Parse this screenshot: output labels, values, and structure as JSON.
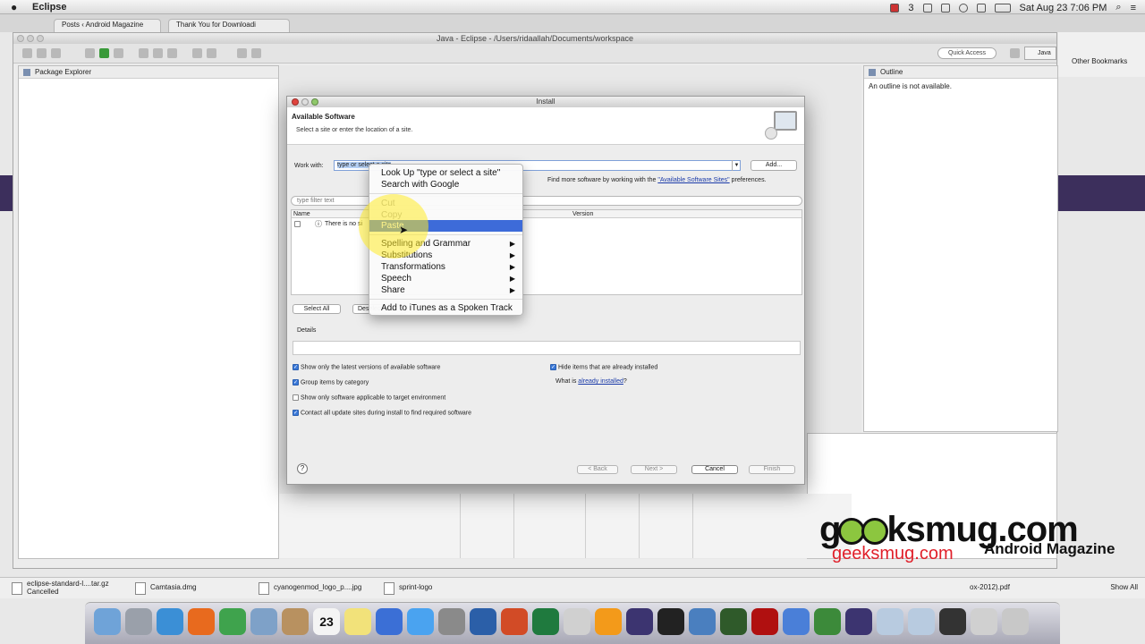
{
  "menubar": {
    "app_name": "Eclipse",
    "apple": "",
    "clock": "Sat Aug 23  7:06 PM",
    "badge": "3"
  },
  "chrome": {
    "tabs": [
      {
        "label": "Posts ‹ Android Magazine",
        "close": "×"
      },
      {
        "label": "Thank You for Downloadi",
        "close": "×"
      }
    ],
    "other_bookmarks": "Other Bookmarks"
  },
  "eclipse": {
    "title": "Java - Eclipse - /Users/ridaallah/Documents/workspace",
    "quick_access": "Quick Access",
    "perspective": "Java",
    "package_explorer": "Package Explorer",
    "outline": "Outline",
    "outline_msg": "An outline is not available."
  },
  "dialog": {
    "title": "Install",
    "heading": "Available Software",
    "subheading": "Select a site or enter the location of a site.",
    "work_with_label": "Work with:",
    "work_with_value": "type or select a site",
    "add_label": "Add...",
    "find_more_prefix": "Find more software by working with the ",
    "find_more_link": "\"Available Software Sites\"",
    "find_more_suffix": " preferences.",
    "filter_placeholder": "type filter text",
    "col_name": "Name",
    "col_version": "Version",
    "row_text": "There is no si",
    "select_all": "Select All",
    "deselect": "Deselect All",
    "details": "Details",
    "options": [
      {
        "label": "Show only the latest versions of available software",
        "checked": true
      },
      {
        "label": "Group items by category",
        "checked": true
      },
      {
        "label": "Show only software applicable to target environment",
        "checked": false
      },
      {
        "label": "Contact all update sites during install to find required software",
        "checked": true
      }
    ],
    "hide_installed": {
      "label": "Hide items that are already installed",
      "checked": true
    },
    "what_is_prefix": "What is ",
    "what_is_link": "already installed",
    "what_is_suffix": "?",
    "buttons": {
      "back": "< Back",
      "next": "Next >",
      "cancel": "Cancel",
      "finish": "Finish"
    },
    "help": "?"
  },
  "context_menu": {
    "items": [
      {
        "label": "Look Up \"type or select a site\""
      },
      {
        "label": "Search with Google"
      },
      {
        "label": "Cut",
        "disabled": true
      },
      {
        "label": "Copy",
        "disabled": true
      },
      {
        "label": "Paste",
        "highlighted": true
      },
      {
        "label": "Spelling and Grammar",
        "submenu": "▶"
      },
      {
        "label": "Substitutions",
        "submenu": "▶"
      },
      {
        "label": "Transformations",
        "submenu": "▶"
      },
      {
        "label": "Speech",
        "submenu": "▶"
      },
      {
        "label": "Share",
        "submenu": "▶"
      },
      {
        "label": "Add to iTunes as a Spoken Track"
      }
    ]
  },
  "downloads": {
    "items": [
      {
        "name": "eclipse-standard-l....tar.gz",
        "status": "Cancelled"
      },
      {
        "name": "Camtasia.dmg"
      },
      {
        "name": "cyanogenmod_logo_p....jpg"
      },
      {
        "name": "sprint-logo"
      }
    ],
    "pdf_fragment": "ox-2012).pdf",
    "show_all": "Show All"
  },
  "dock": {
    "calendar_day": "23",
    "icons": [
      "finder-icon",
      "launchpad-icon",
      "safari-icon",
      "firefox-icon",
      "chrome-icon",
      "mail-icon",
      "contacts-icon",
      "calendar-icon",
      "notes-icon",
      "itunes-icon",
      "appstore-icon",
      "system-preferences-icon",
      "word-icon",
      "powerpoint-icon",
      "excel-icon",
      "preview-icon",
      "vlc-icon",
      "eclipse-icon",
      "terminal-icon",
      "xcode-icon",
      "dreamweaver-icon",
      "acrobat-icon",
      "bluetooth-icon",
      "camtasia-icon",
      "eclipse2-icon",
      "folder-icon",
      "folder2-icon",
      "display-icon",
      "finder2-icon",
      "trash-icon"
    ]
  },
  "watermark": {
    "brand_left": "g",
    "brand_right": "ksmug.com",
    "url": "geeksmug.com",
    "tagline": "Android Magazine"
  }
}
